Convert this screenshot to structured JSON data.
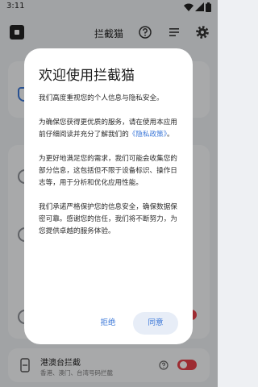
{
  "status_bar": {
    "time": "3:11"
  },
  "app_bar": {
    "title": "拦截猫"
  },
  "background": {
    "bottom_row": {
      "title": "港澳台拦截",
      "subtitle": "香港、澳门、台湾号码拦截"
    }
  },
  "dialog": {
    "title": "欢迎使用拦截猫",
    "p1": "我们高度重视您的个人信息与隐私安全。",
    "p2_before": "为确保您获得更优质的服务，请在使用本应用前仔细阅读并充分了解我们的",
    "p2_link": "《隐私政策》",
    "p2_after": "。",
    "p3": "为更好地满足您的需求，我们可能会收集您的部分信息，这包括但不限于设备标识、操作日志等，用于分析和优化应用性能。",
    "p4": "我们承诺严格保护您的信息安全，确保数据保密可靠。感谢您的信任，我们将不断努力，为您提供卓越的服务体验。",
    "reject_label": "拒绝",
    "agree_label": "同意"
  },
  "colors": {
    "accent": "#3c78d8",
    "toggle_on": "#e8424a",
    "scrim": "rgba(0,0,0,0.32)"
  }
}
